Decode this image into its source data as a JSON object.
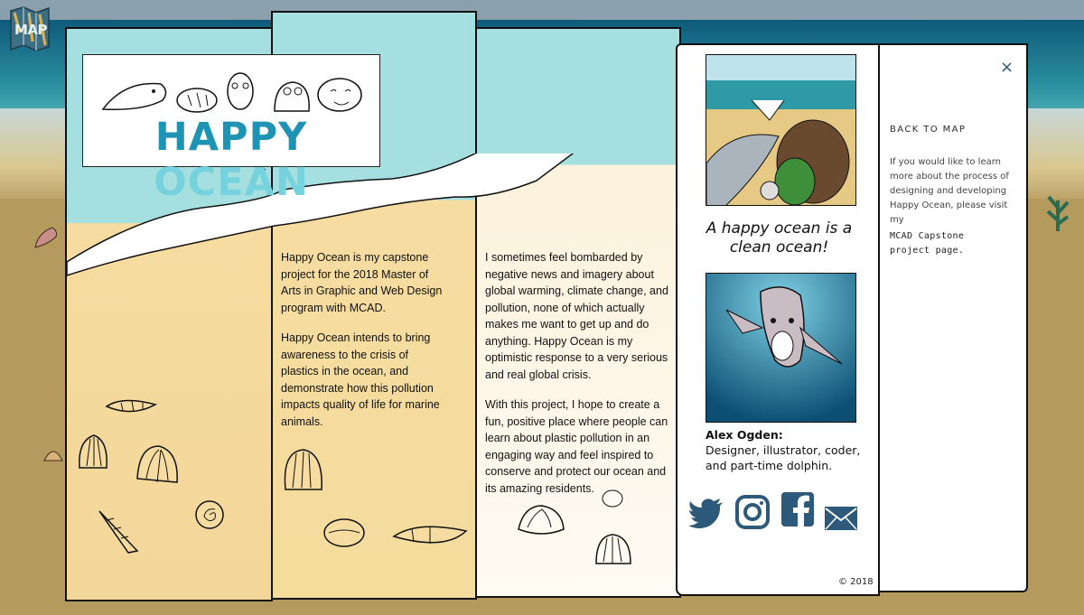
{
  "map_button": {
    "label": "MAP",
    "icon": "folded-map-icon"
  },
  "logo": {
    "title": "HAPPY OCEAN"
  },
  "column_a": {
    "p1": "Happy Ocean is my capstone project for the 2018 Master of Arts in Graphic and Web Design program with MCAD.",
    "p2": "Happy Ocean intends to bring awareness to the crisis of plastics in the ocean, and demonstrate how this pollution impacts quality of life for marine animals."
  },
  "column_b": {
    "p1": "I sometimes feel bombarded by negative news and imagery about global warming, climate change, and pollution, none of which actually makes me want to get up and do anything. Happy Ocean is my optimistic response to a very serious and real global crisis.",
    "p2": "With this project, I hope to create a fun, positive place where people can learn about plastic pollution in an engaging way and feel inspired to conserve and protect our ocean and its amazing residents."
  },
  "sidebar": {
    "tagline": "A happy ocean is a clean ocean!",
    "bio_name": "Alex Ogden:",
    "bio_text": "Designer, illustrator, coder, and part-time dolphin.",
    "socials": [
      "twitter-icon",
      "instagram-icon",
      "facebook-icon",
      "email-icon"
    ],
    "copyright": "© 2018"
  },
  "panel": {
    "close": "×",
    "back_to_map": "BACK TO MAP",
    "learn_more": "If you would like to learn more about the process of designing and developing Happy Ocean, please visit my",
    "capstone_link": "MCAD Capstone project page."
  },
  "colors": {
    "accent_blue": "#2d5a7a",
    "logo_blue_dark": "#1f93b4",
    "logo_blue_light": "#76d3de",
    "water": "#a6dfe0",
    "sand_page": "#f6dca0"
  }
}
